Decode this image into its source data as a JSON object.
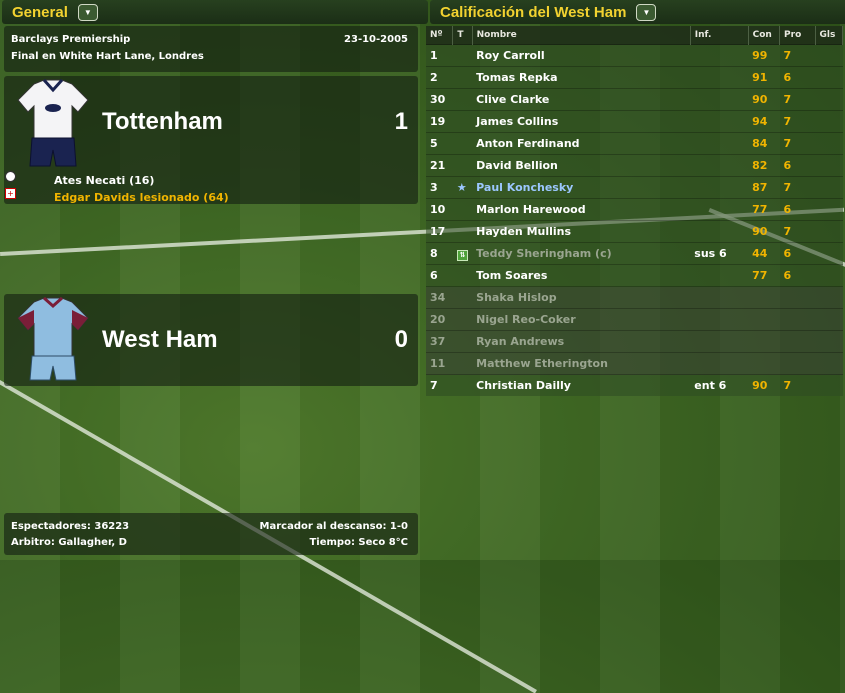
{
  "left_header": {
    "title": "General"
  },
  "right_header": {
    "title": "Calificación del West Ham"
  },
  "match": {
    "competition": "Barclays Premiership",
    "date": "23-10-2005",
    "venue": "Final en White Hart Lane, Londres"
  },
  "home": {
    "name": "Tottenham",
    "score": "1",
    "events": [
      {
        "icon": "ball-icon",
        "text": "Ates Necati (16)",
        "color": "#ffffff"
      },
      {
        "icon": "injury-icon",
        "text": "Edgar Davids lesionado (64)",
        "color": "#f0b400"
      }
    ]
  },
  "away": {
    "name": "West Ham",
    "score": "0"
  },
  "footer": {
    "attendance": "Espectadores: 36223",
    "referee": "Arbitro: Gallagher, D",
    "halftime": "Marcador al descanso: 1-0",
    "weather": "Tiempo: Seco 8°C"
  },
  "table": {
    "headers": [
      "Nº",
      "T",
      "Nombre",
      "Inf.",
      "Con",
      "Pro",
      "Gls"
    ],
    "rows": [
      {
        "num": "1",
        "t": "",
        "name": "Roy Carroll",
        "inf": "",
        "con": "99",
        "pro": "7",
        "gls": "",
        "active": true
      },
      {
        "num": "2",
        "t": "",
        "name": "Tomas Repka",
        "inf": "",
        "con": "91",
        "pro": "6",
        "gls": "",
        "active": true
      },
      {
        "num": "30",
        "t": "",
        "name": "Clive Clarke",
        "inf": "",
        "con": "90",
        "pro": "7",
        "gls": "",
        "active": true
      },
      {
        "num": "19",
        "t": "",
        "name": "James Collins",
        "inf": "",
        "con": "94",
        "pro": "7",
        "gls": "",
        "active": true
      },
      {
        "num": "5",
        "t": "",
        "name": "Anton Ferdinand",
        "inf": "",
        "con": "84",
        "pro": "7",
        "gls": "",
        "active": true
      },
      {
        "num": "21",
        "t": "",
        "name": "David Bellion",
        "inf": "",
        "con": "82",
        "pro": "6",
        "gls": "",
        "active": true
      },
      {
        "num": "3",
        "t": "star",
        "name": "Paul Konchesky",
        "inf": "",
        "con": "87",
        "pro": "7",
        "gls": "",
        "active": true
      },
      {
        "num": "10",
        "t": "",
        "name": "Marlon Harewood",
        "inf": "",
        "con": "77",
        "pro": "6",
        "gls": "",
        "active": true
      },
      {
        "num": "17",
        "t": "",
        "name": "Hayden Mullins",
        "inf": "",
        "con": "90",
        "pro": "7",
        "gls": "",
        "active": true
      },
      {
        "num": "8",
        "t": "sub",
        "name": "Teddy Sheringham (c)",
        "inf": "sus 6",
        "con": "44",
        "pro": "6",
        "gls": "",
        "active": true
      },
      {
        "num": "6",
        "t": "",
        "name": "Tom Soares",
        "inf": "",
        "con": "77",
        "pro": "6",
        "gls": "",
        "active": true
      },
      {
        "num": "34",
        "t": "",
        "name": "Shaka Hislop",
        "inf": "",
        "con": "",
        "pro": "",
        "gls": "",
        "active": false
      },
      {
        "num": "20",
        "t": "",
        "name": "Nigel Reo-Coker",
        "inf": "",
        "con": "",
        "pro": "",
        "gls": "",
        "active": false
      },
      {
        "num": "37",
        "t": "",
        "name": "Ryan Andrews",
        "inf": "",
        "con": "",
        "pro": "",
        "gls": "",
        "active": false
      },
      {
        "num": "11",
        "t": "",
        "name": "Matthew Etherington",
        "inf": "",
        "con": "",
        "pro": "",
        "gls": "",
        "active": false
      },
      {
        "num": "7",
        "t": "",
        "name": "Christian Dailly",
        "inf": "ent 6",
        "con": "90",
        "pro": "7",
        "gls": "",
        "active": true
      }
    ]
  }
}
